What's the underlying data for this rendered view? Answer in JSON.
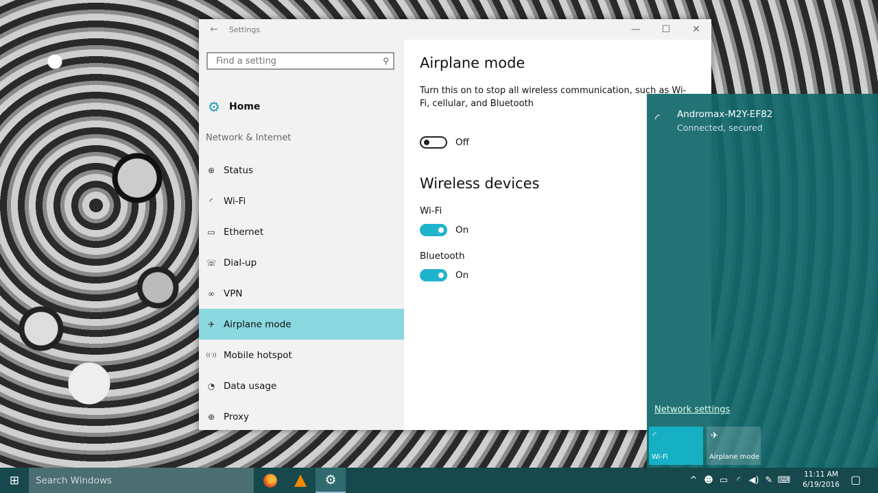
{
  "window": {
    "title": "Settings",
    "back": "←",
    "minimize": "—",
    "maximize": "☐",
    "close": "✕"
  },
  "sidebar": {
    "search_placeholder": "Find a setting",
    "home_label": "Home",
    "group_label": "Network & Internet",
    "items": [
      {
        "label": "Status",
        "icon": "status-icon",
        "glyph": "⊕"
      },
      {
        "label": "Wi-Fi",
        "icon": "wifi-icon",
        "glyph": "◜"
      },
      {
        "label": "Ethernet",
        "icon": "ethernet-icon",
        "glyph": "▭"
      },
      {
        "label": "Dial-up",
        "icon": "dialup-icon",
        "glyph": "☏"
      },
      {
        "label": "VPN",
        "icon": "vpn-icon",
        "glyph": "∞"
      },
      {
        "label": "Airplane mode",
        "icon": "airplane-icon",
        "glyph": "✈",
        "active": true
      },
      {
        "label": "Mobile hotspot",
        "icon": "hotspot-icon",
        "glyph": "((·))"
      },
      {
        "label": "Data usage",
        "icon": "data-usage-icon",
        "glyph": "◔"
      },
      {
        "label": "Proxy",
        "icon": "globe-icon",
        "glyph": "⊕"
      }
    ]
  },
  "content": {
    "title": "Airplane mode",
    "description": "Turn this on to stop all wireless communication, such as Wi-Fi, cellular, and Bluetooth",
    "airplane_toggle_state": "Off",
    "section_title": "Wireless devices",
    "wifi_label": "Wi-Fi",
    "wifi_state": "On",
    "bluetooth_label": "Bluetooth",
    "bluetooth_state": "On"
  },
  "flyout": {
    "network_name": "Andromax-M2Y-EF82",
    "network_status": "Connected, secured",
    "network_settings": "Network settings",
    "tile_wifi": "Wi-Fi",
    "tile_airplane": "Airplane mode"
  },
  "taskbar": {
    "search_placeholder": "Search Windows",
    "time": "11:11 AM",
    "date": "6/19/2016",
    "apps": [
      "firefox-icon",
      "vlc-icon",
      "gear-icon"
    ]
  },
  "colors": {
    "accent": "#1fb3cc",
    "active_nav": "#8ad8e0",
    "flyout_bg": "#12686c",
    "taskbar_bg": "#16484c"
  }
}
